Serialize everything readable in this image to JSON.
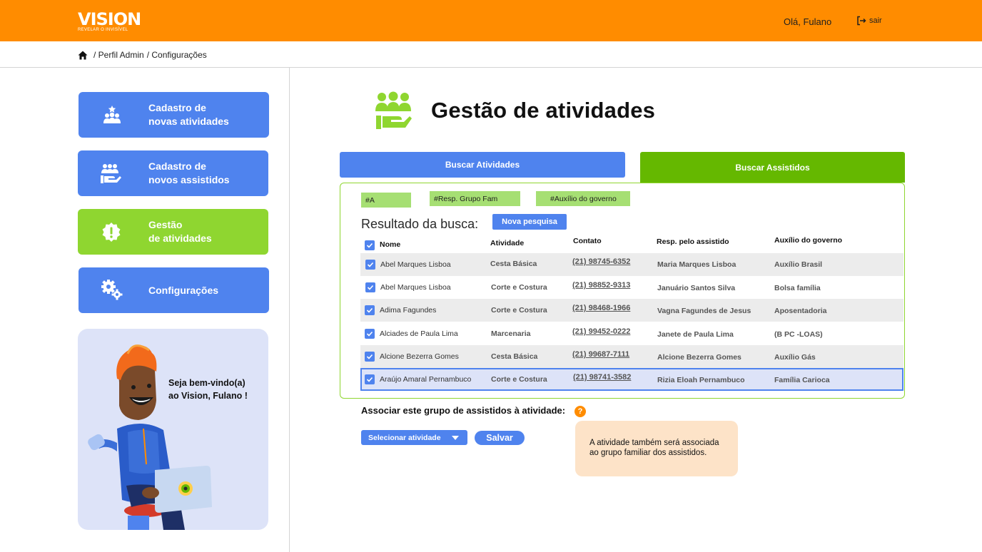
{
  "header": {
    "logo_text": "VISION",
    "logo_tagline": "REVELAR O INVISÍVEL",
    "greeting": "Olá, Fulano",
    "logout_label": "sair"
  },
  "breadcrumb": {
    "items": [
      "/ Perfil Admin",
      "/ Configurações"
    ]
  },
  "sidebar": {
    "items": [
      {
        "line1": "Cadastro de",
        "line2": "novas atividades",
        "icon": "group-star-icon"
      },
      {
        "line1": "Cadastro de",
        "line2": "novos assistidos",
        "icon": "people-hand-icon"
      },
      {
        "line1": "Gestão",
        "line2": "de atividades",
        "icon": "alert-badge-icon",
        "active": true
      },
      {
        "line1": "Configurações",
        "line2": "",
        "icon": "gears-icon"
      }
    ],
    "welcome": {
      "line1": "Seja bem-vindo(a)",
      "line2": "ao Vision, Fulano !"
    }
  },
  "main": {
    "title": "Gestão de atividades",
    "tabs": [
      {
        "label": "Buscar Atividades",
        "active": false
      },
      {
        "label": "Buscar Assistidos",
        "active": true
      }
    ],
    "filters": [
      "#A",
      "#Resp. Grupo Fam",
      "#Auxílio do governo"
    ],
    "result_label": "Resultado da busca:",
    "new_search_label": "Nova pesquisa",
    "table": {
      "columns": [
        "Nome",
        "Atividade",
        "Contato",
        "Resp. pelo assistido",
        "Auxílio do governo"
      ],
      "rows": [
        {
          "name": "Abel Marques Lisboa",
          "activity": "Cesta Básica",
          "contact": "(21) 98745-6352",
          "resp": "Maria Marques Lisboa",
          "aid": "Auxílio Brasil"
        },
        {
          "name": "Abel Marques Lisboa",
          "activity": "Corte e Costura",
          "contact": "(21) 98852-9313",
          "resp": "Januário Santos Silva",
          "aid": "Bolsa família"
        },
        {
          "name": "Adima Fagundes",
          "activity": "Corte e Costura",
          "contact": "(21) 98468-1966",
          "resp": "Vagna Fagundes de Jesus",
          "aid": "Aposentadoria"
        },
        {
          "name": "Alciades de Paula Lima",
          "activity": "Marcenaria",
          "contact": "(21) 99452-0222",
          "resp": "Janete de Paula Lima",
          "aid": "(B PC -LOAS)"
        },
        {
          "name": "Alcione Bezerra Gomes",
          "activity": "Cesta Básica",
          "contact": "(21) 99687-7111",
          "resp": "Alcione Bezerra Gomes",
          "aid": "Auxílio Gás"
        },
        {
          "name": "Araújo Amaral Pernambuco",
          "activity": "Corte e Costura",
          "contact": "(21) 98741-3582",
          "resp": "Rizia Eloah Pernambuco",
          "aid": "Família Carioca"
        }
      ]
    },
    "associate_label": "Associar este grupo de assistidos à atividade:",
    "help_symbol": "?",
    "select_placeholder": "Selecionar atividade",
    "save_label": "Salvar",
    "tooltip": {
      "line1": "A atividade também será associada",
      "line2": "ao grupo familiar dos assistidos."
    }
  },
  "colors": {
    "header": "#ff8c00",
    "primary_blue": "#4f83ee",
    "active_green": "#8fd630",
    "tab_green": "#65b800",
    "chip_green": "#a6df73",
    "tooltip_bg": "#fde3c8",
    "welcome_bg": "#dde3f8"
  }
}
